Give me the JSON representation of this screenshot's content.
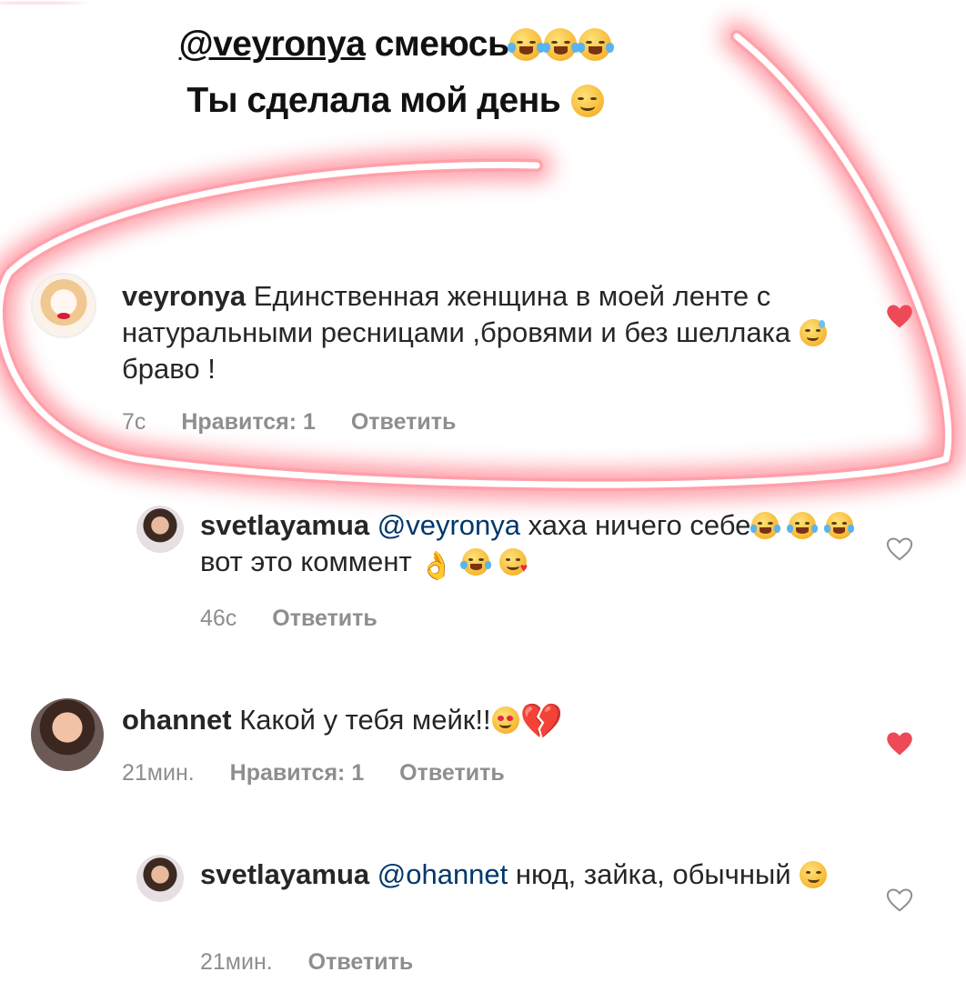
{
  "story_caption": {
    "mention": "@veyronya",
    "line1_rest": " смеюсь",
    "line2": "Ты сделала мой день"
  },
  "colors": {
    "glow": "#ff4d5e",
    "liked_heart": "#ed4956",
    "link": "#00376b",
    "meta": "#8e8e8e"
  },
  "comments": [
    {
      "username": "veyronya",
      "text_1": "Единственная женщина в моей ленте с натуральными ресницами ,бровями и без шеллака",
      "text_2": "браво !",
      "time": "7с",
      "likes": "Нравится: 1",
      "reply": "Ответить",
      "liked": true,
      "like_icon": "heart-filled-icon"
    },
    {
      "username": "svetlayamua",
      "mention": "@veyronya",
      "text_1": "хаха ничего себе",
      "text_2": "вот это коммент",
      "time": "46с",
      "reply": "Ответить",
      "liked": false,
      "like_icon": "heart-outline-icon"
    },
    {
      "username": "ohannet",
      "text_1": "Какой у тебя мейк!!",
      "time": "21мин.",
      "likes": "Нравится: 1",
      "reply": "Ответить",
      "liked": true,
      "like_icon": "heart-filled-icon"
    },
    {
      "username": "svetlayamua",
      "mention": "@ohannet",
      "text_1": "нюд, зайка,",
      "text_2": "обычный",
      "time": "21мин.",
      "reply": "Ответить",
      "liked": false,
      "like_icon": "heart-outline-icon"
    }
  ]
}
